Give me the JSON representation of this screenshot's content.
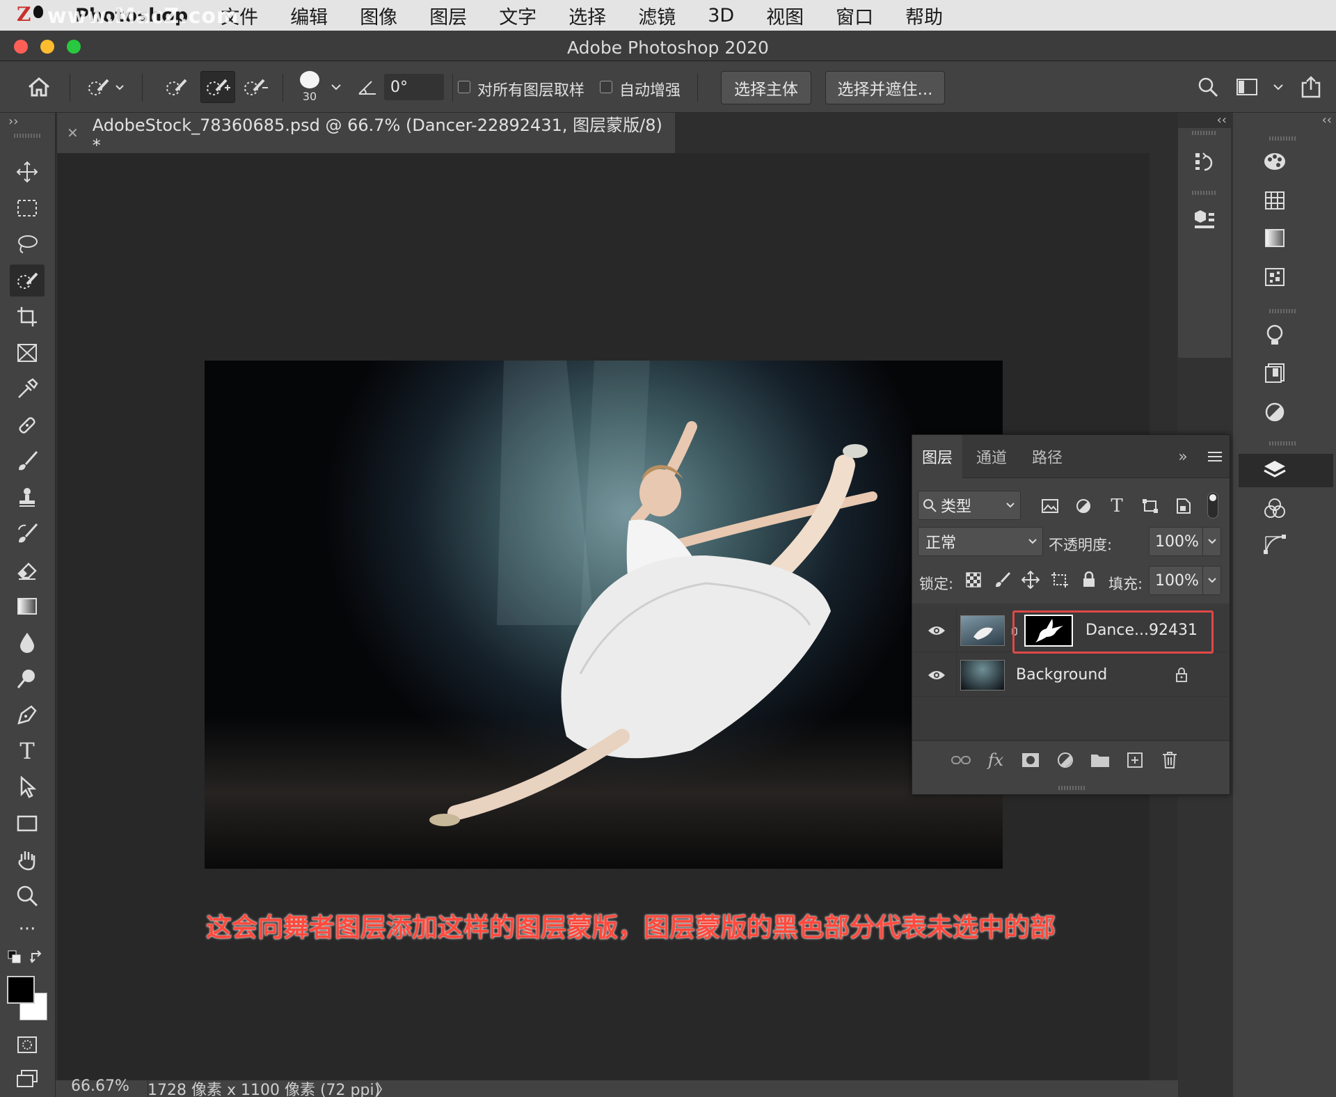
{
  "menubar": {
    "app_name": "Photoshop",
    "watermark": "www.MacZ.com",
    "items": [
      "文件",
      "编辑",
      "图像",
      "图层",
      "文字",
      "选择",
      "滤镜",
      "3D",
      "视图",
      "窗口",
      "帮助"
    ]
  },
  "window": {
    "title": "Adobe Photoshop 2020"
  },
  "options": {
    "brush_size": "30",
    "angle": "0°",
    "sample_all_layers": "对所有图层取样",
    "auto_enhance": "自动增强",
    "select_subject": "选择主体",
    "select_and_mask": "选择并遮住..."
  },
  "document": {
    "tab_title": "AdobeStock_78360685.psd @ 66.7% (Dancer-22892431, 图层蒙版/8) *",
    "caption": "这会向舞者图层添加这样的图层蒙版，图层蒙版的黑色部分代表未选中的部"
  },
  "status": {
    "zoom": "66.67%",
    "doc_info": "1728 像素 x 1100 像素 (72 ppi)",
    "arrow": "〉"
  },
  "layers_panel": {
    "tabs": [
      "图层",
      "通道",
      "路径"
    ],
    "filter_kind": "类型",
    "blend_mode": "正常",
    "opacity_label": "不透明度:",
    "opacity_value": "100%",
    "lock_label": "锁定:",
    "fill_label": "填充:",
    "fill_value": "100%",
    "layers": [
      {
        "name": "Dance...92431",
        "has_mask": true,
        "locked": false
      },
      {
        "name": "Background",
        "has_mask": false,
        "locked": true
      }
    ]
  },
  "colors": {
    "highlight": "#e04848",
    "caption": "#ff4a3d"
  }
}
